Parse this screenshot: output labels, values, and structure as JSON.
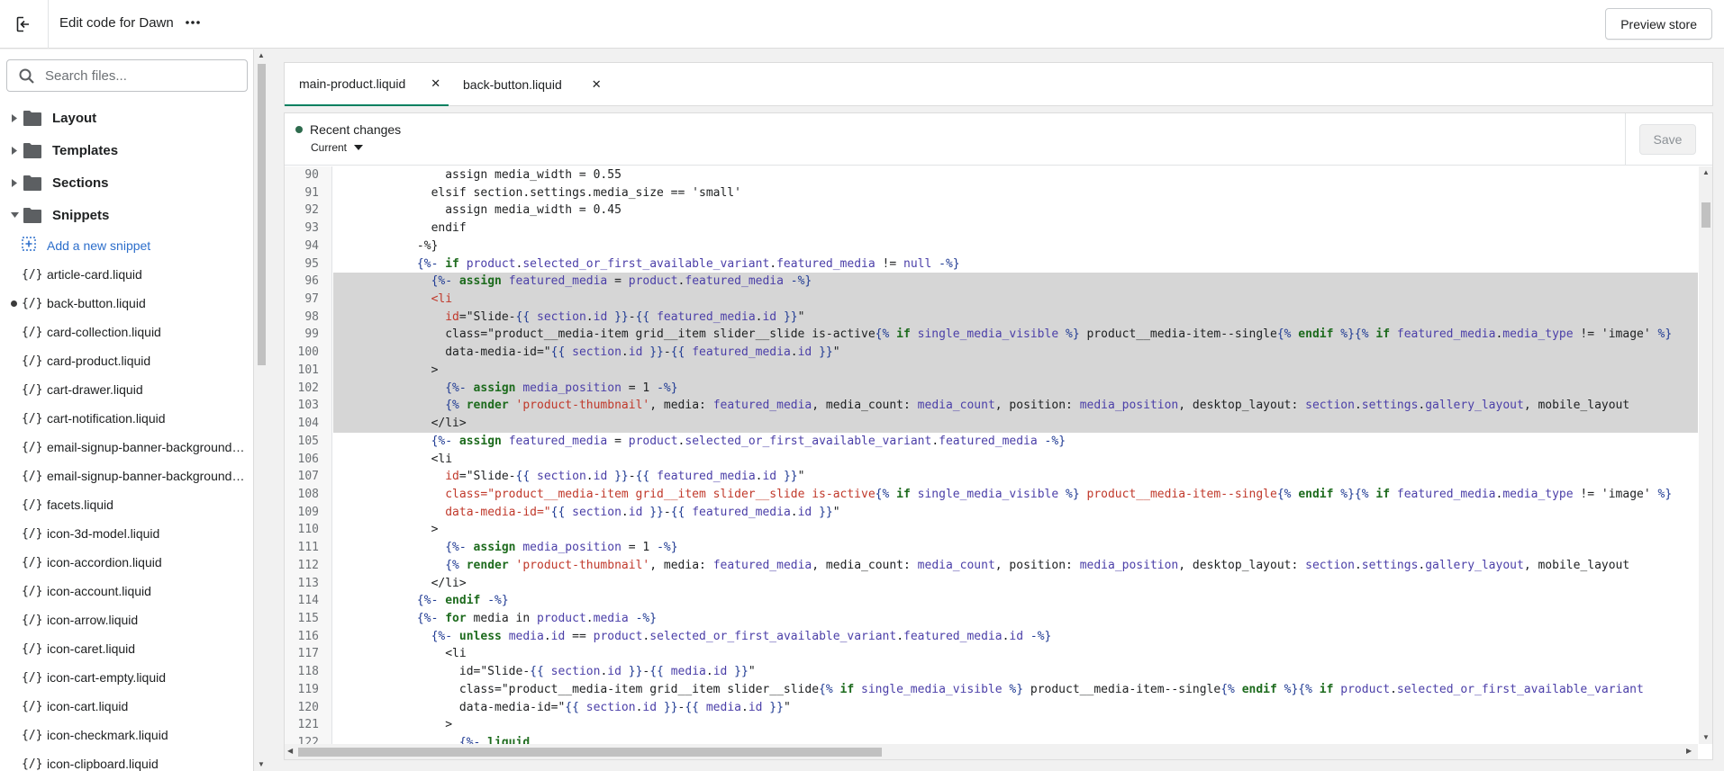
{
  "topbar": {
    "title": "Edit code for Dawn",
    "preview_label": "Preview store"
  },
  "sidebar": {
    "search_placeholder": "Search files...",
    "folders": [
      {
        "label": "Layout",
        "expanded": false
      },
      {
        "label": "Templates",
        "expanded": false
      },
      {
        "label": "Sections",
        "expanded": false
      },
      {
        "label": "Snippets",
        "expanded": true
      }
    ],
    "add_snippet_label": "Add a new snippet",
    "files": [
      {
        "label": "article-card.liquid",
        "modified": false
      },
      {
        "label": "back-button.liquid",
        "modified": true
      },
      {
        "label": "card-collection.liquid",
        "modified": false
      },
      {
        "label": "card-product.liquid",
        "modified": false
      },
      {
        "label": "cart-drawer.liquid",
        "modified": false
      },
      {
        "label": "cart-notification.liquid",
        "modified": false
      },
      {
        "label": "email-signup-banner-background…",
        "modified": false
      },
      {
        "label": "email-signup-banner-background…",
        "modified": false
      },
      {
        "label": "facets.liquid",
        "modified": false
      },
      {
        "label": "icon-3d-model.liquid",
        "modified": false
      },
      {
        "label": "icon-accordion.liquid",
        "modified": false
      },
      {
        "label": "icon-account.liquid",
        "modified": false
      },
      {
        "label": "icon-arrow.liquid",
        "modified": false
      },
      {
        "label": "icon-caret.liquid",
        "modified": false
      },
      {
        "label": "icon-cart-empty.liquid",
        "modified": false
      },
      {
        "label": "icon-cart.liquid",
        "modified": false
      },
      {
        "label": "icon-checkmark.liquid",
        "modified": false
      },
      {
        "label": "icon-clipboard.liquid",
        "modified": false
      }
    ],
    "file_icon": "{/}"
  },
  "tabs": [
    {
      "label": "main-product.liquid",
      "active": true
    },
    {
      "label": "back-button.liquid",
      "active": false
    }
  ],
  "editor": {
    "recent_label": "Recent changes",
    "version_label": "Current",
    "save_label": "Save",
    "lines": [
      {
        "n": "90",
        "hl": false,
        "html": "                assign media_width = 0.55"
      },
      {
        "n": "91",
        "hl": false,
        "html": "              elsif section.settings.media_size == 'small'"
      },
      {
        "n": "92",
        "hl": false,
        "html": "                assign media_width = 0.45"
      },
      {
        "n": "93",
        "hl": false,
        "html": "              endif"
      },
      {
        "n": "94",
        "hl": false,
        "html": "            -%}"
      },
      {
        "n": "95",
        "hl": false,
        "html": "            <span class=\"d\">{%-</span> <span class=\"k\">if</span> <span class=\"v\">product</span>.<span class=\"v\">selected_or_first_available_variant</span>.<span class=\"v\">featured_media</span> != <span class=\"v\">null</span> <span class=\"d\">-%}</span>"
      },
      {
        "n": "96",
        "hl": true,
        "html": "              <span class=\"d\">{%-</span> <span class=\"k\">assign</span> <span class=\"v\">featured_media</span> = <span class=\"v\">product</span>.<span class=\"v\">featured_media</span> <span class=\"d\">-%}</span>"
      },
      {
        "n": "97",
        "hl": true,
        "html": "              <span class=\"tg\">&lt;li</span>"
      },
      {
        "n": "98",
        "hl": true,
        "html": "                <span class=\"s\">id</span>=\"Slide-<span class=\"d\">{{</span> <span class=\"v\">section</span>.<span class=\"v\">id</span> <span class=\"d\">}}</span>-<span class=\"d\">{{</span> <span class=\"v\">featured_media</span>.<span class=\"v\">id</span> <span class=\"d\">}}</span>\""
      },
      {
        "n": "99",
        "hl": true,
        "html": "                class=\"product__media-item grid__item slider__slide is-active<span class=\"d\">{%</span> <span class=\"k\">if</span> <span class=\"v\">single_media_visible</span> <span class=\"d\">%}</span> product__media-item--single<span class=\"d\">{%</span> <span class=\"k\">endif</span> <span class=\"d\">%}{%</span> <span class=\"k\">if</span> <span class=\"v\">featured_media</span>.<span class=\"v\">media_type</span> != 'image' <span class=\"d\">%}</span>"
      },
      {
        "n": "100",
        "hl": true,
        "html": "                data-media-id=\"<span class=\"d\">{{</span> <span class=\"v\">section</span>.<span class=\"v\">id</span> <span class=\"d\">}}</span>-<span class=\"d\">{{</span> <span class=\"v\">featured_media</span>.<span class=\"v\">id</span> <span class=\"d\">}}</span>\""
      },
      {
        "n": "101",
        "hl": true,
        "html": "              &gt;"
      },
      {
        "n": "102",
        "hl": true,
        "html": "                <span class=\"d\">{%-</span> <span class=\"k\">assign</span> <span class=\"v\">media_position</span> = 1 <span class=\"d\">-%}</span>"
      },
      {
        "n": "103",
        "hl": true,
        "html": "                <span class=\"d\">{%</span> <span class=\"k\">render</span> <span class=\"s\">'product-thumbnail'</span>, media: <span class=\"v\">featured_media</span>, media_count: <span class=\"v\">media_count</span>, position: <span class=\"v\">media_position</span>, desktop_layout: <span class=\"v\">section</span>.<span class=\"v\">settings</span>.<span class=\"v\">gallery_layout</span>, mobile_layout"
      },
      {
        "n": "104",
        "hl": true,
        "html": "              &lt;/li&gt;"
      },
      {
        "n": "105",
        "hl": false,
        "html": "              <span class=\"d\">{%-</span> <span class=\"k\">assign</span> <span class=\"v\">featured_media</span> = <span class=\"v\">product</span>.<span class=\"v\">selected_or_first_available_variant</span>.<span class=\"v\">featured_media</span> <span class=\"d\">-%}</span>"
      },
      {
        "n": "106",
        "hl": false,
        "html": "              &lt;li"
      },
      {
        "n": "107",
        "hl": false,
        "html": "                <span class=\"s\">id</span>=\"Slide-<span class=\"d\">{{</span> <span class=\"v\">section</span>.<span class=\"v\">id</span> <span class=\"d\">}}</span>-<span class=\"d\">{{</span> <span class=\"v\">featured_media</span>.<span class=\"v\">id</span> <span class=\"d\">}}</span>\""
      },
      {
        "n": "108",
        "hl": false,
        "html": "                <span class=\"s\">class=\"product__media-item grid__item slider__slide is-active</span><span class=\"d\">{%</span> <span class=\"k\">if</span> <span class=\"v\">single_media_visible</span> <span class=\"d\">%}</span> <span class=\"s\">product__media-item--single</span><span class=\"d\">{%</span> <span class=\"k\">endif</span> <span class=\"d\">%}{%</span> <span class=\"k\">if</span> <span class=\"v\">featured_media</span>.<span class=\"v\">media_type</span> != 'image' <span class=\"d\">%}</span>"
      },
      {
        "n": "109",
        "hl": false,
        "html": "                <span class=\"s\">data-media-id=\"</span><span class=\"d\">{{</span> <span class=\"v\">section</span>.<span class=\"v\">id</span> <span class=\"d\">}}</span>-<span class=\"d\">{{</span> <span class=\"v\">featured_media</span>.<span class=\"v\">id</span> <span class=\"d\">}}</span>\""
      },
      {
        "n": "110",
        "hl": false,
        "html": "              &gt;"
      },
      {
        "n": "111",
        "hl": false,
        "html": "                <span class=\"d\">{%-</span> <span class=\"k\">assign</span> <span class=\"v\">media_position</span> = 1 <span class=\"d\">-%}</span>"
      },
      {
        "n": "112",
        "hl": false,
        "html": "                <span class=\"d\">{%</span> <span class=\"k\">render</span> <span class=\"s\">'product-thumbnail'</span>, media: <span class=\"v\">featured_media</span>, media_count: <span class=\"v\">media_count</span>, position: <span class=\"v\">media_position</span>, desktop_layout: <span class=\"v\">section</span>.<span class=\"v\">settings</span>.<span class=\"v\">gallery_layout</span>, mobile_layout"
      },
      {
        "n": "113",
        "hl": false,
        "html": "              &lt;/li&gt;"
      },
      {
        "n": "114",
        "hl": false,
        "html": "            <span class=\"d\">{%-</span> <span class=\"k\">endif</span> <span class=\"d\">-%}</span>"
      },
      {
        "n": "115",
        "hl": false,
        "html": "            <span class=\"d\">{%-</span> <span class=\"k\">for</span> media in <span class=\"v\">product</span>.<span class=\"v\">media</span> <span class=\"d\">-%}</span>"
      },
      {
        "n": "116",
        "hl": false,
        "html": "              <span class=\"d\">{%-</span> <span class=\"k\">unless</span> <span class=\"v\">media</span>.<span class=\"v\">id</span> == <span class=\"v\">product</span>.<span class=\"v\">selected_or_first_available_variant</span>.<span class=\"v\">featured_media</span>.<span class=\"v\">id</span> <span class=\"d\">-%}</span>"
      },
      {
        "n": "117",
        "hl": false,
        "html": "                &lt;li"
      },
      {
        "n": "118",
        "hl": false,
        "html": "                  id=\"Slide-<span class=\"d\">{{</span> <span class=\"v\">section</span>.<span class=\"v\">id</span> <span class=\"d\">}}</span>-<span class=\"d\">{{</span> <span class=\"v\">media</span>.<span class=\"v\">id</span> <span class=\"d\">}}</span>\""
      },
      {
        "n": "119",
        "hl": false,
        "html": "                  class=\"product__media-item grid__item slider__slide<span class=\"d\">{%</span> <span class=\"k\">if</span> <span class=\"v\">single_media_visible</span> <span class=\"d\">%}</span> product__media-item--single<span class=\"d\">{%</span> <span class=\"k\">endif</span> <span class=\"d\">%}{%</span> <span class=\"k\">if</span> <span class=\"v\">product</span>.<span class=\"v\">selected_or_first_available_variant</span>"
      },
      {
        "n": "120",
        "hl": false,
        "html": "                  data-media-id=\"<span class=\"d\">{{</span> <span class=\"v\">section</span>.<span class=\"v\">id</span> <span class=\"d\">}}</span>-<span class=\"d\">{{</span> <span class=\"v\">media</span>.<span class=\"v\">id</span> <span class=\"d\">}}</span>\""
      },
      {
        "n": "121",
        "hl": false,
        "html": "                &gt;"
      },
      {
        "n": "122",
        "hl": false,
        "html": "                  <span class=\"d\">{%-</span> <span class=\"k\">liquid</span>"
      }
    ]
  },
  "icons": {
    "exit": "exit-icon",
    "more": "more-horizontal-icon",
    "search": "search-icon",
    "folder": "folder-icon",
    "add": "add-snippet-icon"
  },
  "colors": {
    "accent": "#008060",
    "link": "#2c6ecb",
    "keyword": "#1d6b1d",
    "string": "#c0392b"
  }
}
